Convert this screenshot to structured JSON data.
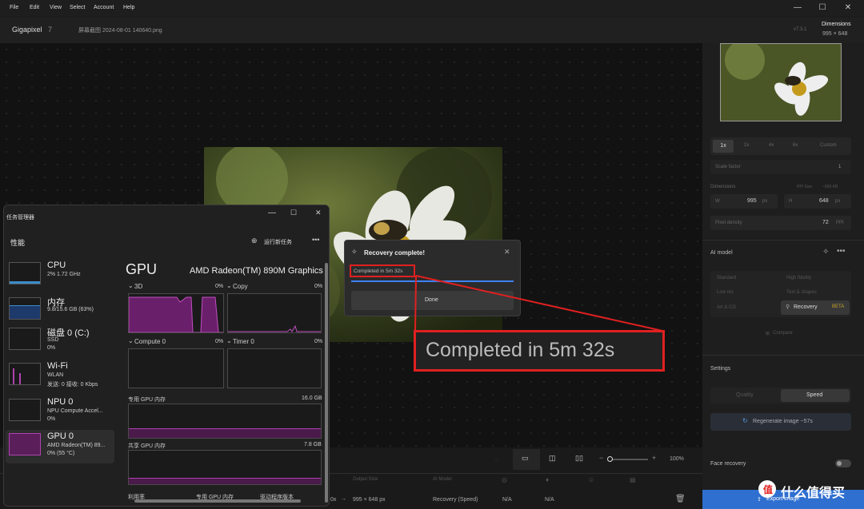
{
  "menu": {
    "file": "File",
    "edit": "Edit",
    "view": "View",
    "select": "Select",
    "account": "Account",
    "help": "Help"
  },
  "app": {
    "name": "Gigapixel",
    "version_major": "7",
    "filename": "屏幕截图 2024-08-01 140640.png",
    "version": "v7.3.1",
    "dimensions_label": "Dimensions",
    "dimensions_value": "995 × 648"
  },
  "right_panel": {
    "scale_options": [
      "1x",
      "2x",
      "4x",
      "6x",
      "Custom"
    ],
    "scale_factor_label": "Scale factor",
    "scale_factor_value": "1",
    "dimensions_label": "Dimensions",
    "ppi_size": "PPI Size",
    "ppi_value": "~960 KB",
    "w_label": "W",
    "w_value": "995",
    "w_unit": "px",
    "h_label": "H",
    "h_value": "648",
    "h_unit": "px",
    "pixel_density_label": "Pixel density",
    "pixel_density_value": "72",
    "pixel_density_unit": "PPI",
    "ai_model_label": "AI model",
    "models": [
      "Standard",
      "High fidelity",
      "Low res",
      "Text & shapes",
      "Art & CG",
      "Recovery"
    ],
    "beta": "BETA",
    "compare": "Compare",
    "settings_label": "Settings",
    "quality": "Quality",
    "speed": "Speed",
    "regenerate": "Regenerate image ~57s",
    "face_recovery": "Face recovery",
    "export": "Export image"
  },
  "canvas_toolbar": {
    "zoom": "100%",
    "minus": "−",
    "plus": "+"
  },
  "bottom_table": {
    "headers": [
      "Output Size",
      "AI Model"
    ],
    "row": {
      "scale": "0x",
      "output": "995 × 648 px",
      "model": "Recovery (Speed)",
      "na1": "N/A",
      "na2": "N/A"
    }
  },
  "taskmgr": {
    "title": "任务管理器",
    "section": "性能",
    "run_task": "运行新任务",
    "items": [
      {
        "name": "CPU",
        "l2": "2% 1.72 GHz",
        "l3": ""
      },
      {
        "name": "内存",
        "l2": "9.8/15.6 GB (63%)",
        "l3": ""
      },
      {
        "name": "磁盘 0 (C:)",
        "l2": "SSD",
        "l3": "0%"
      },
      {
        "name": "Wi-Fi",
        "l2": "WLAN",
        "l3": "发送: 0 接收: 0 Kbps"
      },
      {
        "name": "NPU 0",
        "l2": "NPU Compute Accel...",
        "l3": "0%"
      },
      {
        "name": "GPU 0",
        "l2": "AMD Radeon(TM) 89...",
        "l3": "0% (55 °C)"
      }
    ],
    "gpu_title": "GPU",
    "gpu_model": "AMD Radeon(TM) 890M Graphics",
    "engines": [
      {
        "name": "3D",
        "pct": "0%"
      },
      {
        "name": "Copy",
        "pct": "0%"
      },
      {
        "name": "Compute 0",
        "pct": "0%"
      },
      {
        "name": "Timer 0",
        "pct": "0%"
      }
    ],
    "dedicated_label": "专用 GPU 内存",
    "dedicated_value": "16.0 GB",
    "shared_label": "共享 GPU 内存",
    "shared_value": "7.8 GB",
    "footer": [
      "利用率",
      "专用 GPU 内存",
      "驱动程序版本"
    ]
  },
  "dialog": {
    "title": "Recovery complete!",
    "status": "Completed in 5m 32s",
    "done": "Done",
    "progress": 1.0
  },
  "callout": {
    "text": "Completed in 5m 32s"
  },
  "watermark": {
    "text": "什么值得买"
  }
}
